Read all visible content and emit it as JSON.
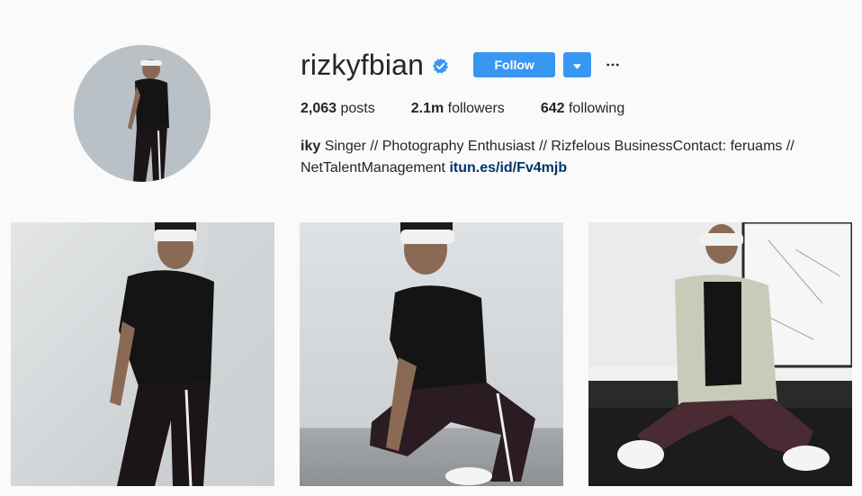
{
  "profile": {
    "username": "rizkyfbian",
    "verified": true,
    "follow_label": "Follow",
    "more_label": "•••",
    "stats": {
      "posts_count": "2,063",
      "posts_label": "posts",
      "followers_count": "2.1m",
      "followers_label": "followers",
      "following_count": "642",
      "following_label": "following"
    },
    "bio": {
      "name": "iky",
      "text": "Singer // Photography Enthusiast // Rizfelous BusinessContact: feruams // NetTalentManagement",
      "link": "itun.es/id/Fv4mjb"
    }
  },
  "posts": [
    {
      "subject": "standing against wall"
    },
    {
      "subject": "crouching"
    },
    {
      "subject": "sitting on sofa"
    }
  ],
  "colors": {
    "accent": "#3897f0",
    "link": "#003569",
    "background": "#fafafa",
    "verified_badge": "#3897f0"
  },
  "icons": [
    "verified-badge-icon",
    "chevron-down-icon",
    "more-options-icon"
  ]
}
